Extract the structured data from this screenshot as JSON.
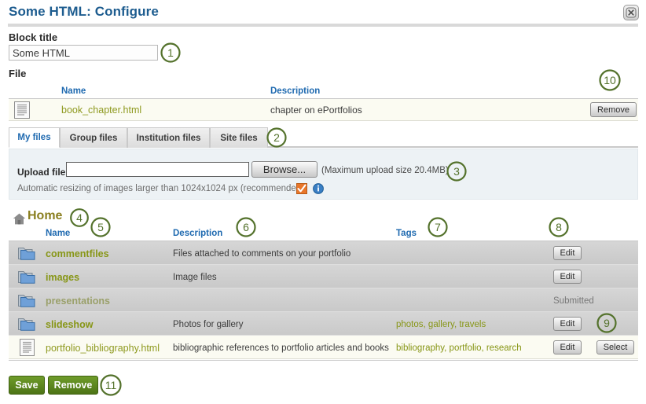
{
  "window": {
    "title": "Some HTML: Configure",
    "close_icon": "close-icon"
  },
  "block_title": {
    "label": "Block title",
    "value": "Some HTML"
  },
  "file_section": {
    "label": "File",
    "headers": {
      "name": "Name",
      "description": "Description"
    },
    "row": {
      "icon": "html-file-icon",
      "name": "book_chapter.html",
      "description": "chapter on ePortfolios",
      "remove_label": "Remove"
    }
  },
  "tabs": [
    {
      "label": "My files",
      "active": true
    },
    {
      "label": "Group files",
      "active": false
    },
    {
      "label": "Institution files",
      "active": false
    },
    {
      "label": "Site files",
      "active": false
    }
  ],
  "upload": {
    "label": "Upload file",
    "value": "",
    "placeholder": "",
    "browse_label": "Browse...",
    "max_size_note": "(Maximum upload size 20.4MB)",
    "resize_note": "Automatic resizing of images larger than 1024x1024 px (recommended)",
    "resize_checked": true,
    "checkbox_icon": "checked-checkbox-icon",
    "info_icon": "info-icon"
  },
  "breadcrumb": {
    "home_icon": "home-icon",
    "home_label": "Home"
  },
  "browser": {
    "headers": {
      "name": "Name",
      "description": "Description",
      "tags": "Tags"
    },
    "rows": [
      {
        "icon": "folder-icon",
        "name": "commentfiles",
        "description": "Files attached to comments on your portfolio",
        "tags": "",
        "status": "",
        "edit_label": "Edit",
        "select_label": "",
        "disabled": false,
        "style": "shade"
      },
      {
        "icon": "folder-icon",
        "name": "images",
        "description": "Image files",
        "tags": "",
        "status": "",
        "edit_label": "Edit",
        "select_label": "",
        "disabled": false,
        "style": "shade"
      },
      {
        "icon": "folder-icon",
        "name": "presentations",
        "description": "",
        "tags": "",
        "status": "Submitted",
        "edit_label": "",
        "select_label": "",
        "disabled": true,
        "style": "shade"
      },
      {
        "icon": "folder-icon",
        "name": "slideshow",
        "description": "Photos for gallery",
        "tags": "photos, gallery, travels",
        "status": "",
        "edit_label": "Edit",
        "select_label": "",
        "disabled": false,
        "style": "shade"
      },
      {
        "icon": "html-file-icon",
        "name": "portfolio_bibliography.html",
        "description": "bibliographic references to portfolio articles and books",
        "tags": "bibliography, portfolio, research",
        "status": "",
        "edit_label": "Edit",
        "select_label": "Select",
        "disabled": false,
        "style": "cream"
      }
    ]
  },
  "footer": {
    "save_label": "Save",
    "remove_label": "Remove"
  },
  "callouts": [
    {
      "n": "1"
    },
    {
      "n": "2"
    },
    {
      "n": "3"
    },
    {
      "n": "4"
    },
    {
      "n": "5"
    },
    {
      "n": "6"
    },
    {
      "n": "7"
    },
    {
      "n": "8"
    },
    {
      "n": "9"
    },
    {
      "n": "10"
    },
    {
      "n": "11"
    }
  ],
  "colors": {
    "title_blue": "#1d5c8f",
    "header_blue": "#1f6ab0",
    "link_olive": "#879616",
    "callout_green": "#54722c",
    "button_green": "#5d8a20",
    "upload_panel": "#edf2f5"
  }
}
